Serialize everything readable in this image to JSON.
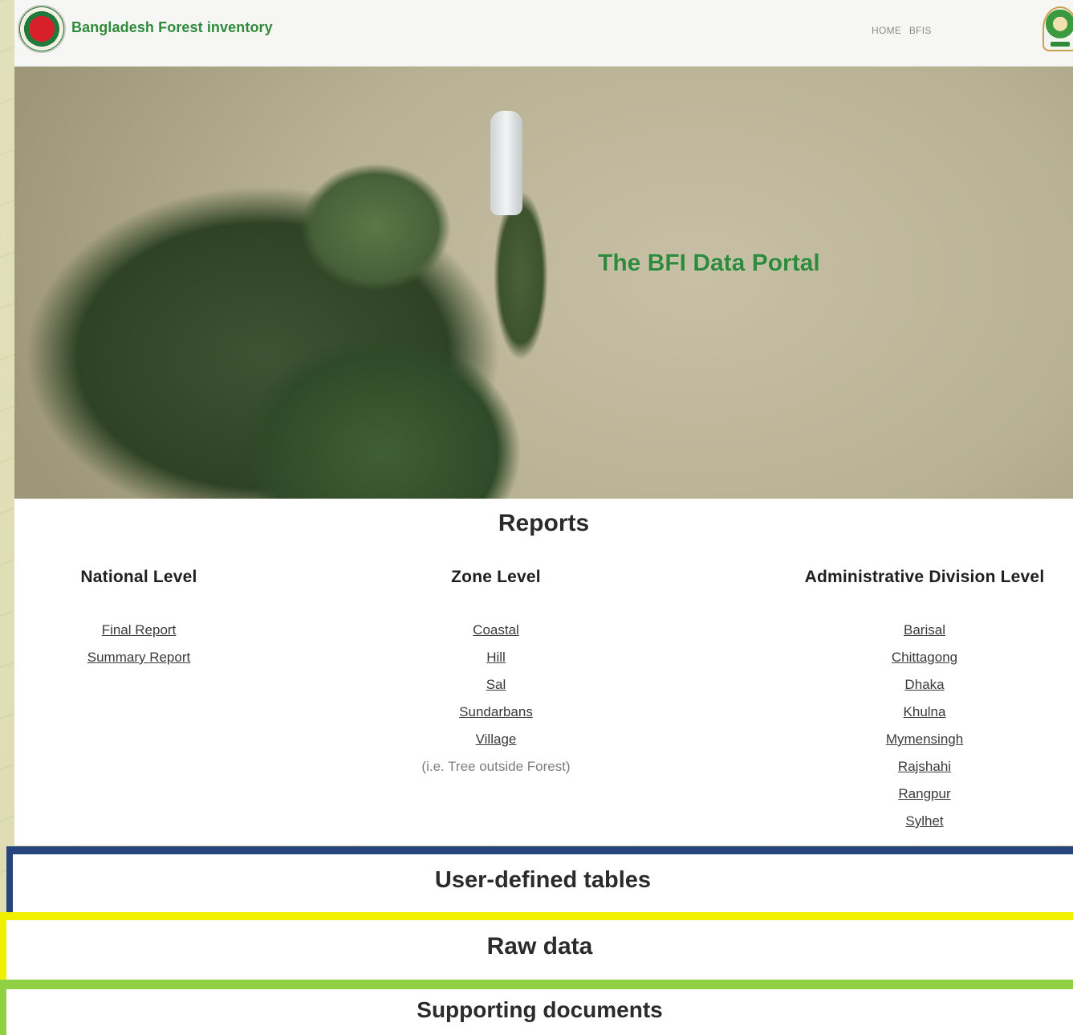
{
  "header": {
    "site_title": "Bangladesh Forest inventory",
    "nav_items": [
      "HOME",
      "BFIS"
    ],
    "logo_icon": "bangladesh-govt-seal-icon",
    "emblem_icon": "forest-department-emblem-icon"
  },
  "hero": {
    "title": "The BFI Data Portal",
    "body_text": "",
    "title_color": "#2f8a3b"
  },
  "reports": {
    "title": "Reports",
    "national": {
      "heading": "National Level",
      "links": [
        "Final Report",
        "Summary Report"
      ]
    },
    "zone": {
      "heading": "Zone Level",
      "links": [
        "Coastal",
        "Hill",
        "Sal",
        "Sundarbans",
        "Village"
      ],
      "note": "(i.e. Tree outside Forest)"
    },
    "admin": {
      "heading": "Administrative Division Level",
      "links": [
        "Barisal",
        "Chittagong",
        "Dhaka",
        "Khulna",
        "Mymensingh",
        "Rajshahi",
        "Rangpur",
        "Sylhet"
      ]
    }
  },
  "sections": {
    "user_tables": "User-defined tables",
    "raw_data": "Raw data",
    "supporting_docs": "Supporting documents"
  },
  "colors": {
    "user_tables_accent": "#27457d",
    "raw_data_accent": "#f1f000",
    "supporting_docs_accent": "#8fd142"
  }
}
